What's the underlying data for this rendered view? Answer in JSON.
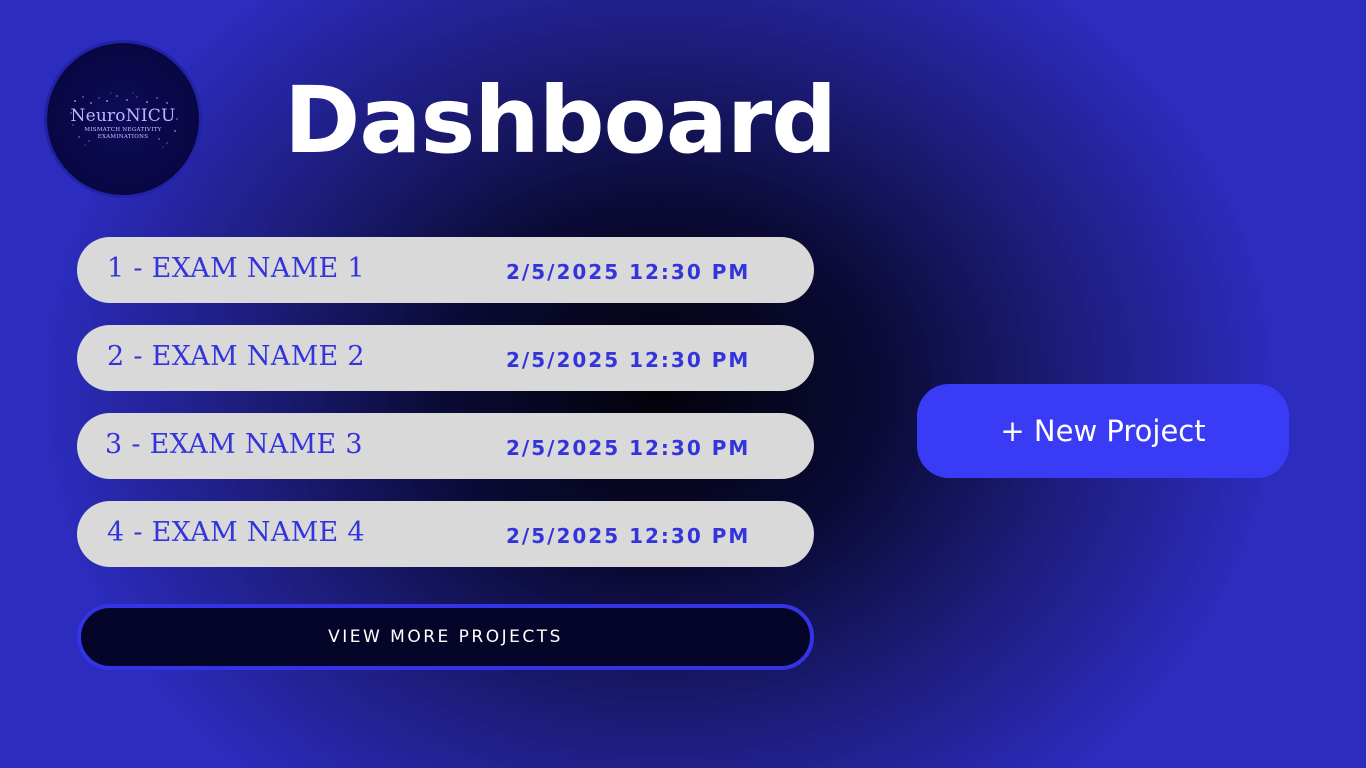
{
  "logo": {
    "title": "NeuroNICU",
    "subtitle_line1": "MISMATCH NEGATIVITY",
    "subtitle_line2": "EXAMINATIONS"
  },
  "page_title": "Dashboard",
  "exams": [
    {
      "name": "1 - EXAM NAME 1",
      "datetime": "2/5/2025 12:30 PM"
    },
    {
      "name": "2 - EXAM NAME 2",
      "datetime": "2/5/2025 12:30 PM"
    },
    {
      "name": "3 - EXAM NAME 3",
      "datetime": "2/5/2025 12:30 PM"
    },
    {
      "name": "4 - EXAM NAME 4",
      "datetime": "2/5/2025 12:30 PM"
    }
  ],
  "view_more_label": "VIEW MORE PROJECTS",
  "new_project_label": "+ New Project",
  "colors": {
    "accent": "#3a3cf5",
    "exam_text": "#3434dc",
    "row_background": "#d9d9d9",
    "background_edge": "#2c2cbf",
    "background_center": "#02020a"
  }
}
